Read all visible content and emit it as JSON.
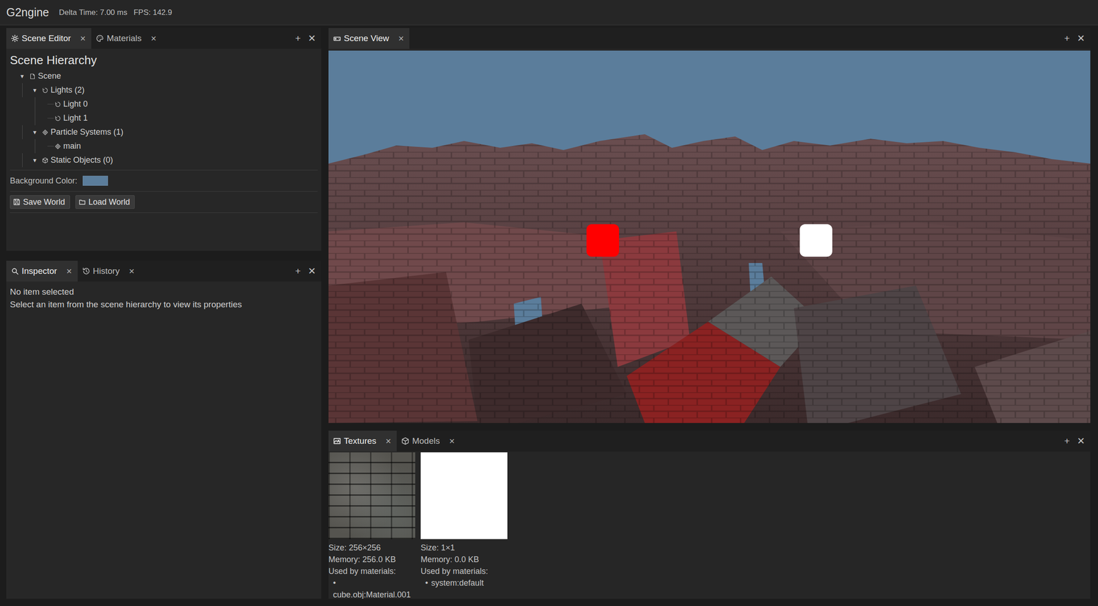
{
  "window": {
    "title": "G2ngine",
    "stats": [
      "Delta Time: 7.00 ms",
      "FPS: 142.9"
    ]
  },
  "scene_editor": {
    "tabs": [
      {
        "label": "Scene Editor",
        "kind": "gear",
        "selected": true,
        "close": "✕"
      },
      {
        "label": "Materials",
        "kind": "palette",
        "selected": false,
        "close": "✕"
      }
    ],
    "actions": [
      "+",
      "✕"
    ],
    "heading": "Scene Hierarchy",
    "tree": [
      {
        "label": "Scene",
        "kind": "scene",
        "toggle": "▼",
        "expanded": true,
        "children": [
          {
            "label": "Lights (2)",
            "kind": "light",
            "toggle": "▼",
            "expanded": true,
            "children": [
              {
                "label": "Light 0",
                "kind": "light"
              },
              {
                "label": "Light 1",
                "kind": "light"
              }
            ]
          },
          {
            "label": "Particle Systems (1)",
            "kind": "particles",
            "toggle": "▼",
            "expanded": true,
            "children": [
              {
                "label": "main",
                "kind": "particles"
              }
            ]
          },
          {
            "label": "Static Objects (0)",
            "kind": "box",
            "toggle": "▼",
            "expanded": true,
            "children": []
          }
        ]
      }
    ],
    "background": {
      "label": "Background Color:",
      "color": "#5b7d9b"
    },
    "buttons": [
      {
        "label": "Save World",
        "kind": "save"
      },
      {
        "label": "Load World",
        "kind": "load"
      }
    ]
  },
  "inspector": {
    "tabs": [
      {
        "label": "Inspector",
        "kind": "search",
        "selected": true,
        "close": "✕"
      },
      {
        "label": "History",
        "kind": "history",
        "selected": false,
        "close": "✕"
      }
    ],
    "actions": [
      "+",
      "✕"
    ],
    "message": "No item selected",
    "hint": "Select an item from the scene hierarchy to view its properties"
  },
  "scene_view": {
    "tabs": [
      {
        "label": "Scene View",
        "kind": "gamepad",
        "selected": true,
        "close": "✕"
      }
    ],
    "actions": [
      "+",
      "✕"
    ],
    "lights": [
      {
        "color": "#ff0000"
      },
      {
        "color": "#ffffff"
      }
    ]
  },
  "textures": {
    "tabs": [
      {
        "label": "Textures",
        "kind": "image",
        "selected": true,
        "close": "✕"
      },
      {
        "label": "Models",
        "kind": "cube",
        "selected": false,
        "close": "✕"
      }
    ],
    "actions": [
      "+",
      "✕"
    ],
    "items": [
      {
        "kind": "bitmap",
        "color": "#55544f",
        "size": "Size: 256×256",
        "memory": "Memory: 256.0 KB",
        "used_label": "Used by materials:",
        "bullet": "•",
        "materials": [
          "cube.obj:Material.001"
        ]
      },
      {
        "kind": "solid",
        "color": "#ffffff",
        "size": "Size: 1×1",
        "memory": "Memory: 0.0 KB",
        "used_label": "Used by materials:",
        "bullet": "•",
        "materials": [
          "system:default"
        ]
      }
    ]
  }
}
